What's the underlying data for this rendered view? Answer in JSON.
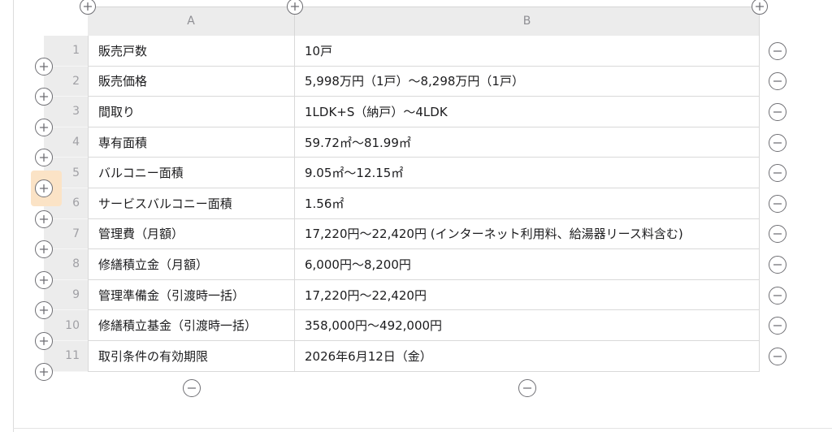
{
  "sheet": {
    "columns": [
      {
        "label": "A"
      },
      {
        "label": "B"
      }
    ],
    "rows": [
      {
        "num": "1",
        "a": "販売戸数",
        "b": "10戸"
      },
      {
        "num": "2",
        "a": "販売価格",
        "b": "5,998万円（1戸）～8,298万円（1戸）"
      },
      {
        "num": "3",
        "a": "間取り",
        "b": "1LDK+S（納戸）～4LDK"
      },
      {
        "num": "4",
        "a": "専有面積",
        "b": "59.72㎡～81.99㎡"
      },
      {
        "num": "5",
        "a": "バルコニー面積",
        "b": "9.05㎡～12.15㎡"
      },
      {
        "num": "6",
        "a": "サービスバルコニー面積",
        "b": "1.56㎡"
      },
      {
        "num": "7",
        "a": "管理費（月額）",
        "b": "17,220円～22,420円 (インターネット利用料、給湯器リース料含む)"
      },
      {
        "num": "8",
        "a": "修繕積立金（月額）",
        "b": "6,000円～8,200円"
      },
      {
        "num": "9",
        "a": "管理準備金（引渡時一括）",
        "b": "17,220円～22,420円"
      },
      {
        "num": "10",
        "a": "修繕積立基金（引渡時一括）",
        "b": "358,000円～492,000円"
      },
      {
        "num": "11",
        "a": "取引条件の有効期限",
        "b": "2026年6月12日（金）"
      }
    ]
  },
  "colors": {
    "header_bg": "#ececec",
    "grid_line": "#d9d9d9",
    "highlight": "#fbe3c6",
    "icon": "#6e6e73"
  },
  "icons": {
    "add": "plus-circle-icon",
    "remove": "minus-circle-icon"
  }
}
